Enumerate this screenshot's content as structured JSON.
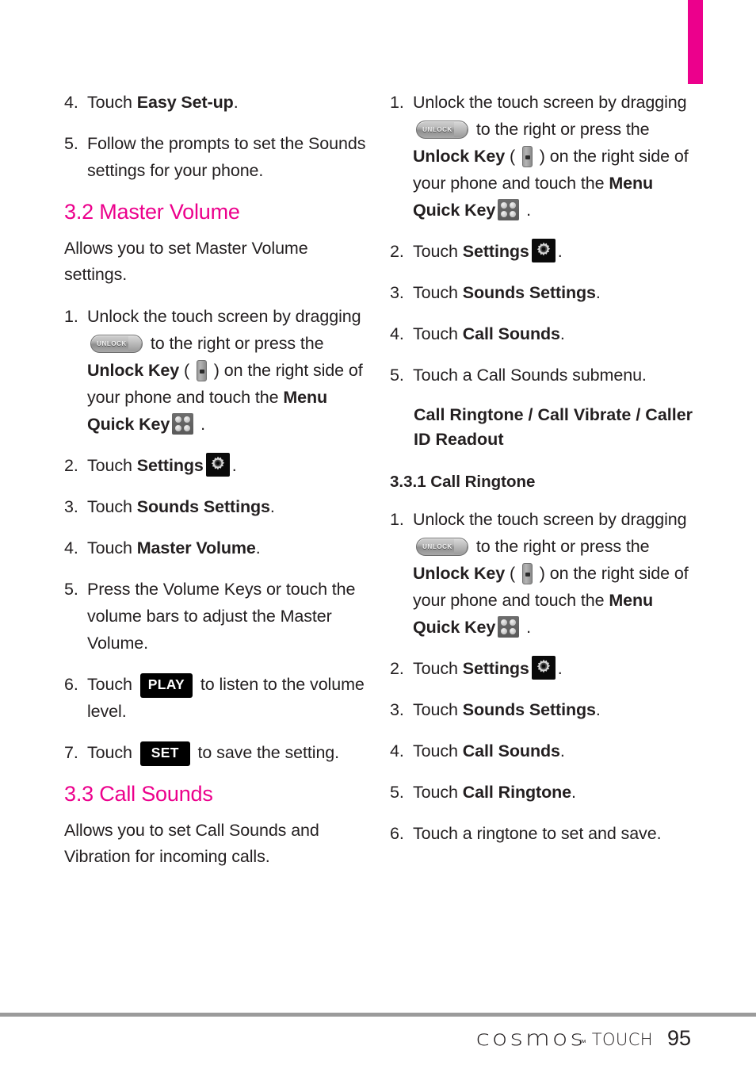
{
  "page": {
    "number": "95",
    "brand": "cosmos",
    "trademark": "™",
    "product": "TOUCH",
    "accent_color": "#ec008c",
    "text_color": "#231f20"
  },
  "icons": {
    "unlock_slider_label": "UNLOCK",
    "unlock_key_name": "unlock-key-icon",
    "menu_quick_key_name": "menu-quick-key-icon",
    "settings_gear_name": "settings-gear-icon"
  },
  "left_column": {
    "steps_top": [
      {
        "num": "4.",
        "pre": "Touch ",
        "bold": "Easy Set-up",
        "post": "."
      },
      {
        "num": "5.",
        "pre": "Follow the prompts to set the Sounds settings for your phone.",
        "bold": "",
        "post": ""
      }
    ],
    "heading_32": "3.2 Master Volume",
    "intro_32": "Allows you to set Master Volume settings.",
    "unlock_step": {
      "num": "1.",
      "t1": "Unlock the touch screen by dragging ",
      "t2": " to the right or press the ",
      "b1": "Unlock Key",
      "t3": " ( ",
      "t4": " ) on the right side of your phone and touch the ",
      "b2": "Menu Quick Key",
      "t5": " ."
    },
    "steps": [
      {
        "num": "2.",
        "pre": "Touch ",
        "bold": "Settings",
        "icon": "settings-gear",
        "post": "."
      },
      {
        "num": "3.",
        "pre": "Touch ",
        "bold": "Sounds Settings",
        "post": "."
      },
      {
        "num": "4.",
        "pre": "Touch ",
        "bold": "Master Volume",
        "post": "."
      },
      {
        "num": "5.",
        "pre": "Press the Volume Keys or touch the volume bars to adjust the Master Volume.",
        "bold": "",
        "post": ""
      }
    ],
    "step6": {
      "num": "6.",
      "pre": "Touch ",
      "button": "PLAY",
      "post": " to listen to the volume level."
    },
    "step7": {
      "num": "7.",
      "pre": "Touch ",
      "button": "SET",
      "post": " to save the setting."
    },
    "heading_33": "3.3 Call Sounds",
    "intro_33": "Allows you to set Call Sounds and Vibration for incoming calls."
  },
  "right_column": {
    "unlock_step": {
      "num": "1.",
      "t1": "Unlock the touch screen by dragging ",
      "t2": " to the right or press the ",
      "b1": "Unlock Key",
      "t3": " ( ",
      "t4": " ) on the right side of your phone and touch the ",
      "b2": "Menu Quick Key",
      "t5": " ."
    },
    "steps_a": [
      {
        "num": "2.",
        "pre": "Touch ",
        "bold": "Settings",
        "icon": "settings-gear",
        "post": "."
      },
      {
        "num": "3.",
        "pre": "Touch ",
        "bold": "Sounds Settings",
        "post": "."
      },
      {
        "num": "4.",
        "pre": "Touch ",
        "bold": "Call Sounds",
        "post": "."
      },
      {
        "num": "5.",
        "pre": "Touch a Call Sounds submenu.",
        "bold": "",
        "post": ""
      }
    ],
    "submenu_list": "Call Ringtone / Call Vibrate / Caller ID Readout",
    "heading_331": "3.3.1 Call Ringtone",
    "unlock_step2": {
      "num": "1.",
      "t1": "Unlock the touch screen by dragging ",
      "t2": " to the right or press the ",
      "b1": "Unlock Key",
      "t3": " ( ",
      "t4": " ) on the right side of your phone and touch the ",
      "b2": "Menu Quick Key",
      "t5": " ."
    },
    "steps_b": [
      {
        "num": "2.",
        "pre": "Touch ",
        "bold": "Settings",
        "icon": "settings-gear",
        "post": "."
      },
      {
        "num": "3.",
        "pre": "Touch ",
        "bold": "Sounds Settings",
        "post": "."
      },
      {
        "num": "4.",
        "pre": "Touch ",
        "bold": "Call Sounds",
        "post": "."
      },
      {
        "num": "5.",
        "pre": "Touch ",
        "bold": "Call Ringtone",
        "post": "."
      },
      {
        "num": "6.",
        "pre": "Touch a ringtone to set and save.",
        "bold": "",
        "post": ""
      }
    ]
  }
}
